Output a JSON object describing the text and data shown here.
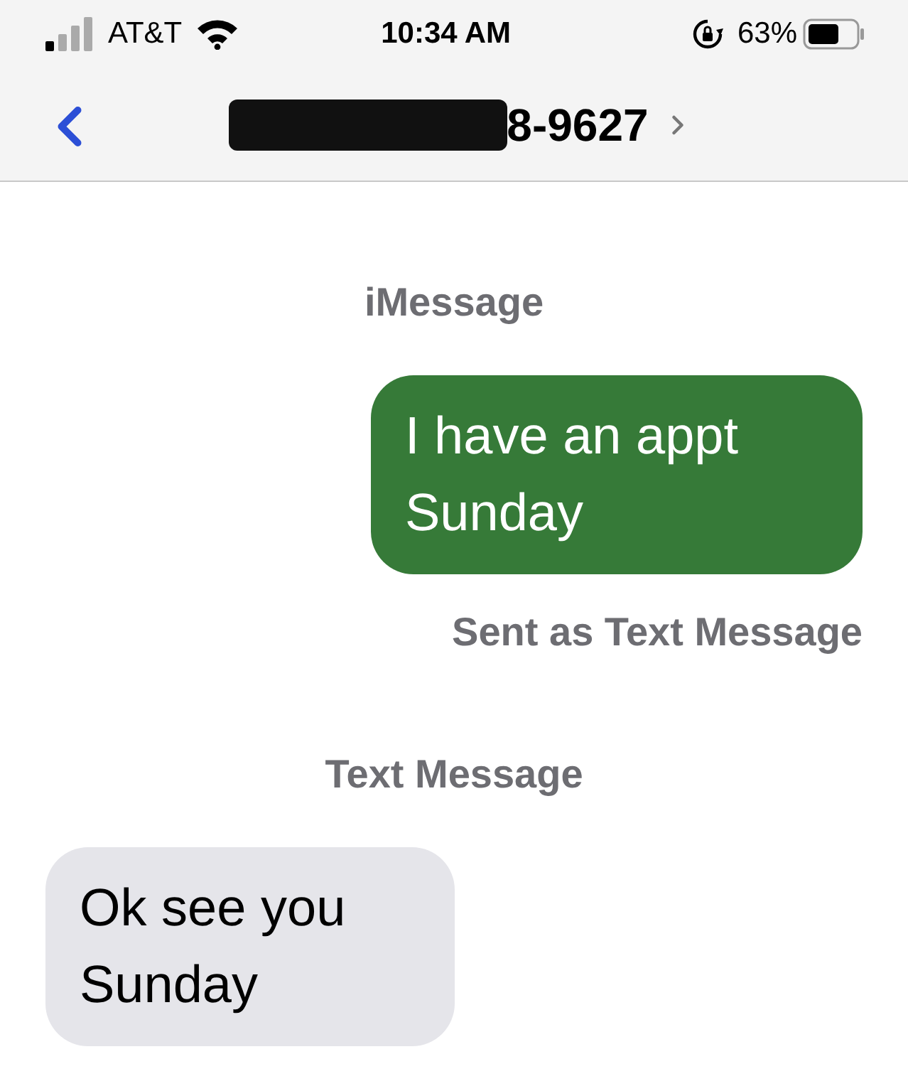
{
  "status_bar": {
    "carrier": "AT&T",
    "time": "10:34 AM",
    "battery": "63%"
  },
  "nav": {
    "title": "8-9627",
    "redacted": true
  },
  "thread": [
    {
      "kind": "service",
      "text": "iMessage"
    },
    {
      "kind": "sent",
      "text": "I have an appt Sunday"
    },
    {
      "kind": "note",
      "text": "Sent as Text Message"
    },
    {
      "kind": "service",
      "text": "Text Message"
    },
    {
      "kind": "received",
      "text": "Ok see you Sunday"
    }
  ]
}
